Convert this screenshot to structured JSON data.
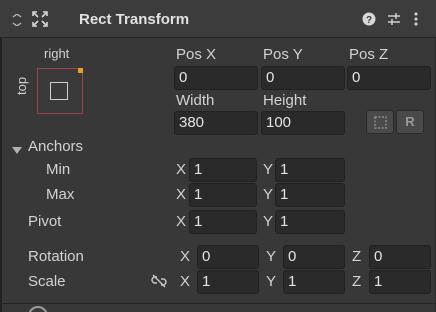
{
  "component": {
    "title": "Rect Transform"
  },
  "anchor_preset": {
    "horizontal_label": "right",
    "vertical_label": "top"
  },
  "position": {
    "pos_x_label": "Pos X",
    "pos_x": "0",
    "pos_y_label": "Pos Y",
    "pos_y": "0",
    "pos_z_label": "Pos Z",
    "pos_z": "0"
  },
  "size": {
    "width_label": "Width",
    "width": "380",
    "height_label": "Height",
    "height": "100"
  },
  "blueprint_buttons": {
    "raw_label": "R"
  },
  "anchors": {
    "label": "Anchors",
    "min_label": "Min",
    "min_x": "1",
    "min_y": "1",
    "max_label": "Max",
    "max_x": "1",
    "max_y": "1"
  },
  "pivot": {
    "label": "Pivot",
    "x": "1",
    "y": "1"
  },
  "rotation": {
    "label": "Rotation",
    "x": "0",
    "y": "0",
    "z": "0"
  },
  "scale": {
    "label": "Scale",
    "x": "1",
    "y": "1",
    "z": "1"
  },
  "axis": {
    "x": "X",
    "y": "Y",
    "z": "Z"
  },
  "colors": {
    "background": "#383838",
    "header": "#3c3c3c",
    "field": "#2a2a2a",
    "anchor_border": "#a04545",
    "anchor_dot": "#e8a020"
  },
  "icons": [
    "drag-handle-icon",
    "move-arrows-icon",
    "help-icon",
    "preset-sliders-icon",
    "kebab-menu-icon",
    "foldout-arrow-icon",
    "unlink-scale-icon",
    "blueprint-mode-icon"
  ]
}
